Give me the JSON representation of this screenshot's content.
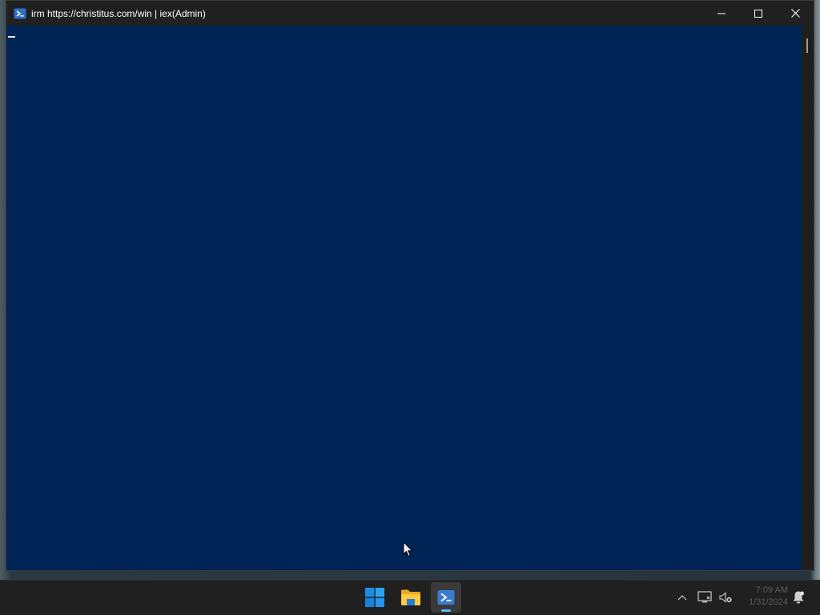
{
  "window": {
    "title": "irm https://christitus.com/win | iex(Admin)",
    "app_icon": "powershell-icon",
    "controls": [
      "minimize-icon",
      "maximize-icon",
      "close-icon"
    ],
    "console_background": "#012456"
  },
  "taskbar": {
    "items": [
      {
        "name": "start-button",
        "icon": "windows-logo-icon"
      },
      {
        "name": "file-explorer-button",
        "icon": "folder-icon"
      },
      {
        "name": "powershell-taskbar-button",
        "icon": "powershell-icon",
        "active": true
      }
    ],
    "tray": {
      "icons": [
        "chevron-up-icon",
        "network-icon",
        "volume-icon",
        "notification-icon"
      ],
      "time": "7:09 AM",
      "date": "1/31/2024"
    }
  },
  "colors": {
    "console": "#012456",
    "titlebar": "#202020",
    "taskbar": "#202020",
    "accent": "#4cc2ff"
  }
}
